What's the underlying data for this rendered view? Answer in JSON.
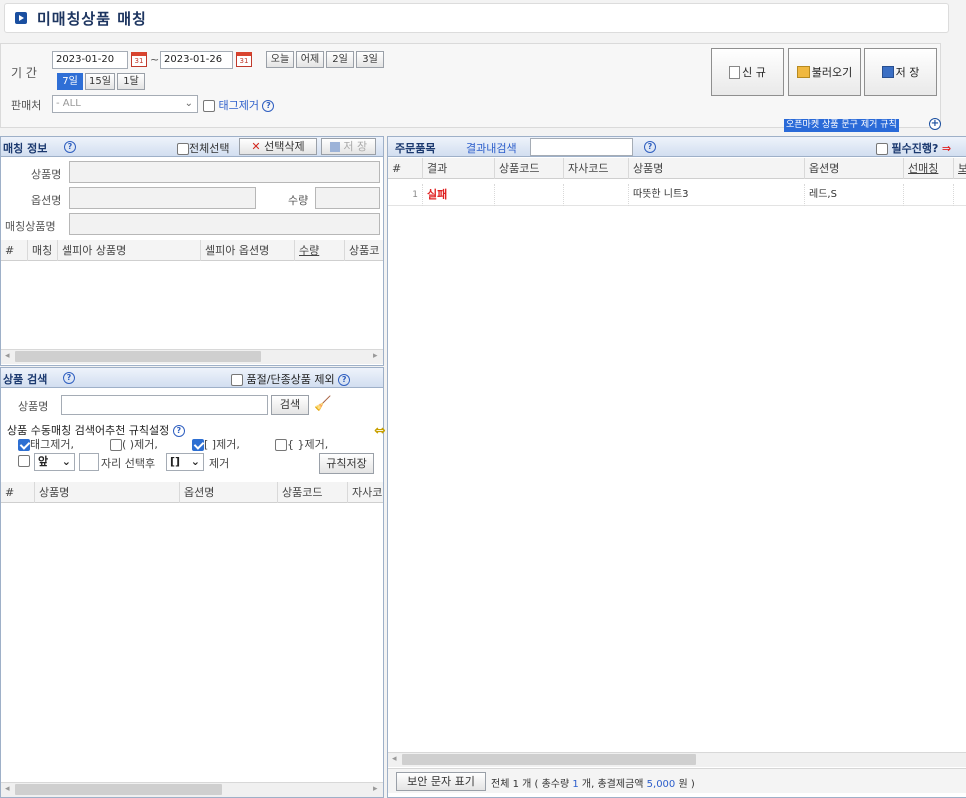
{
  "page": {
    "title": "미매칭상품 매칭"
  },
  "search": {
    "period_label": "기 간",
    "date_from": "2023-01-20",
    "tilde": "~",
    "date_to": "2023-01-26",
    "quick_today": "오늘",
    "quick_yesterday": "어제",
    "quick_2day": "2일",
    "quick_3day": "3일",
    "quick_7day": "7일",
    "quick_15day": "15일",
    "quick_1month": "1달",
    "seller_label": "판매처",
    "seller_value": "- ALL",
    "remove_tags_label": "태그제거",
    "help": "?"
  },
  "toolbar": {
    "new_label": "신 규",
    "load_label": "불러오기",
    "save_label": "저 장",
    "openmarket_rule": "오픈마켓 상품 문구 제거 규칙"
  },
  "matching": {
    "title": "매칭 정보",
    "select_all": "전체선택",
    "delete_selected": "선택삭제",
    "save": "저 장",
    "product_name_label": "상품명",
    "option_name_label": "옵션명",
    "qty_label": "수량",
    "matching_product_label": "매칭상품명",
    "columns": [
      "#",
      "매칭",
      "셀피아 상품명",
      "셀피아 옵션명",
      "수량",
      "상품코"
    ]
  },
  "product_search": {
    "title": "상품 검색",
    "exclude_label": "품절/단종상품 제외",
    "product_name_label": "상품명",
    "search_button": "검색",
    "rule_title": "상품 수동매칭 검색어추천 규칙설정",
    "rule_tag": "태그제거,",
    "rule_paren": "( )제거,",
    "rule_bracket": "[ ]제거,",
    "rule_brace": "{ }제거,",
    "position_value": "앞",
    "after_select": "자리 선택후",
    "bracket_value": "[]",
    "remove": "제거",
    "save_rule": "규칙저장",
    "columns": [
      "#",
      "상품명",
      "옵션명",
      "상품코드",
      "자사코"
    ]
  },
  "orders": {
    "title": "주문품목",
    "result_search": "결과내검색",
    "required_progress": "필수진행?",
    "columns": [
      "#",
      "결과",
      "상품코드",
      "자사코드",
      "상품명",
      "옵션명",
      "선매칭",
      "보"
    ],
    "rows": [
      {
        "no": "1",
        "result": "실패",
        "product_code": "",
        "own_code": "",
        "product_name": "따뜻한 니트3",
        "option_name": "레드,S",
        "pre_match": ""
      }
    ],
    "secure_text_button": "보안 문자 표기",
    "summary_prefix": "전체 1 개 ( 총수량 ",
    "summary_qty": "1",
    "summary_mid": " 개, 총결제금액 ",
    "summary_amount": "5,000",
    "summary_suffix": " 원 )"
  },
  "colors": {
    "accent": "#2c5ecb",
    "fail": "#e02020",
    "panel_header": "#d2def0"
  }
}
